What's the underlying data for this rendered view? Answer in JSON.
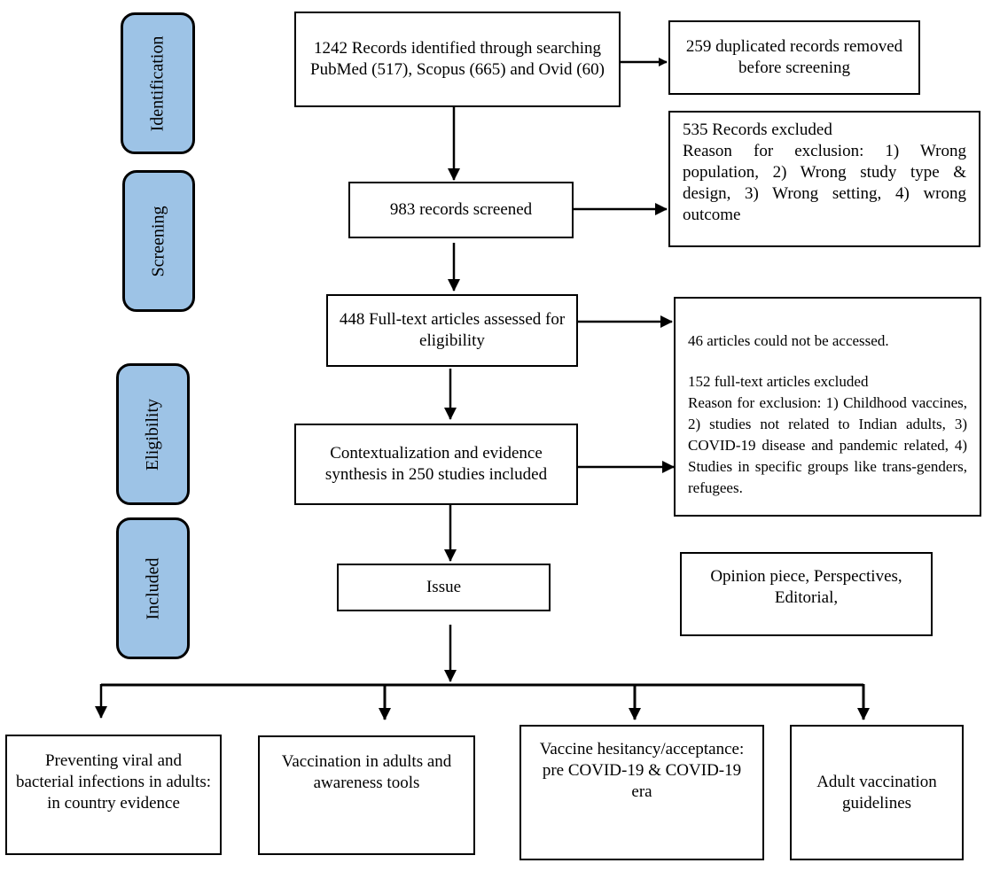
{
  "stages": [
    {
      "label": "Identification"
    },
    {
      "label": "Screening"
    },
    {
      "label": "Eligibility"
    },
    {
      "label": "Included"
    }
  ],
  "boxes": {
    "identified": "1242 Records identified through searching PubMed (517), Scopus (665) and Ovid (60)",
    "duplicates": "259 duplicated records removed before screening",
    "screened": "983 records screened",
    "excluded_screening": {
      "title": "535 Records excluded",
      "reason": "Reason for exclusion: 1) Wrong population, 2) Wrong study type & design, 3) Wrong setting, 4) wrong outcome"
    },
    "fulltext": "448 Full-text articles assessed for eligibility",
    "excluded_fulltext": {
      "not_accessed": "46 articles could not be accessed.",
      "title": "152 full-text articles excluded",
      "reason": "Reason for exclusion: 1) Childhood vaccines, 2) studies not related to Indian adults, 3) COVID-19 disease and pandemic related, 4) Studies in specific groups like trans-genders, refugees."
    },
    "synthesis": "Contextualization and evidence synthesis in 250 studies included",
    "issue": "Issue",
    "opinion": "Opinion piece, Perspectives, Editorial,"
  },
  "outcomes": [
    "Preventing viral and bacterial infections in adults: in country evidence",
    "Vaccination in adults and awareness tools",
    "Vaccine hesitancy/acceptance: pre COVID-19 & COVID-19 era",
    "Adult vaccination guidelines"
  ]
}
